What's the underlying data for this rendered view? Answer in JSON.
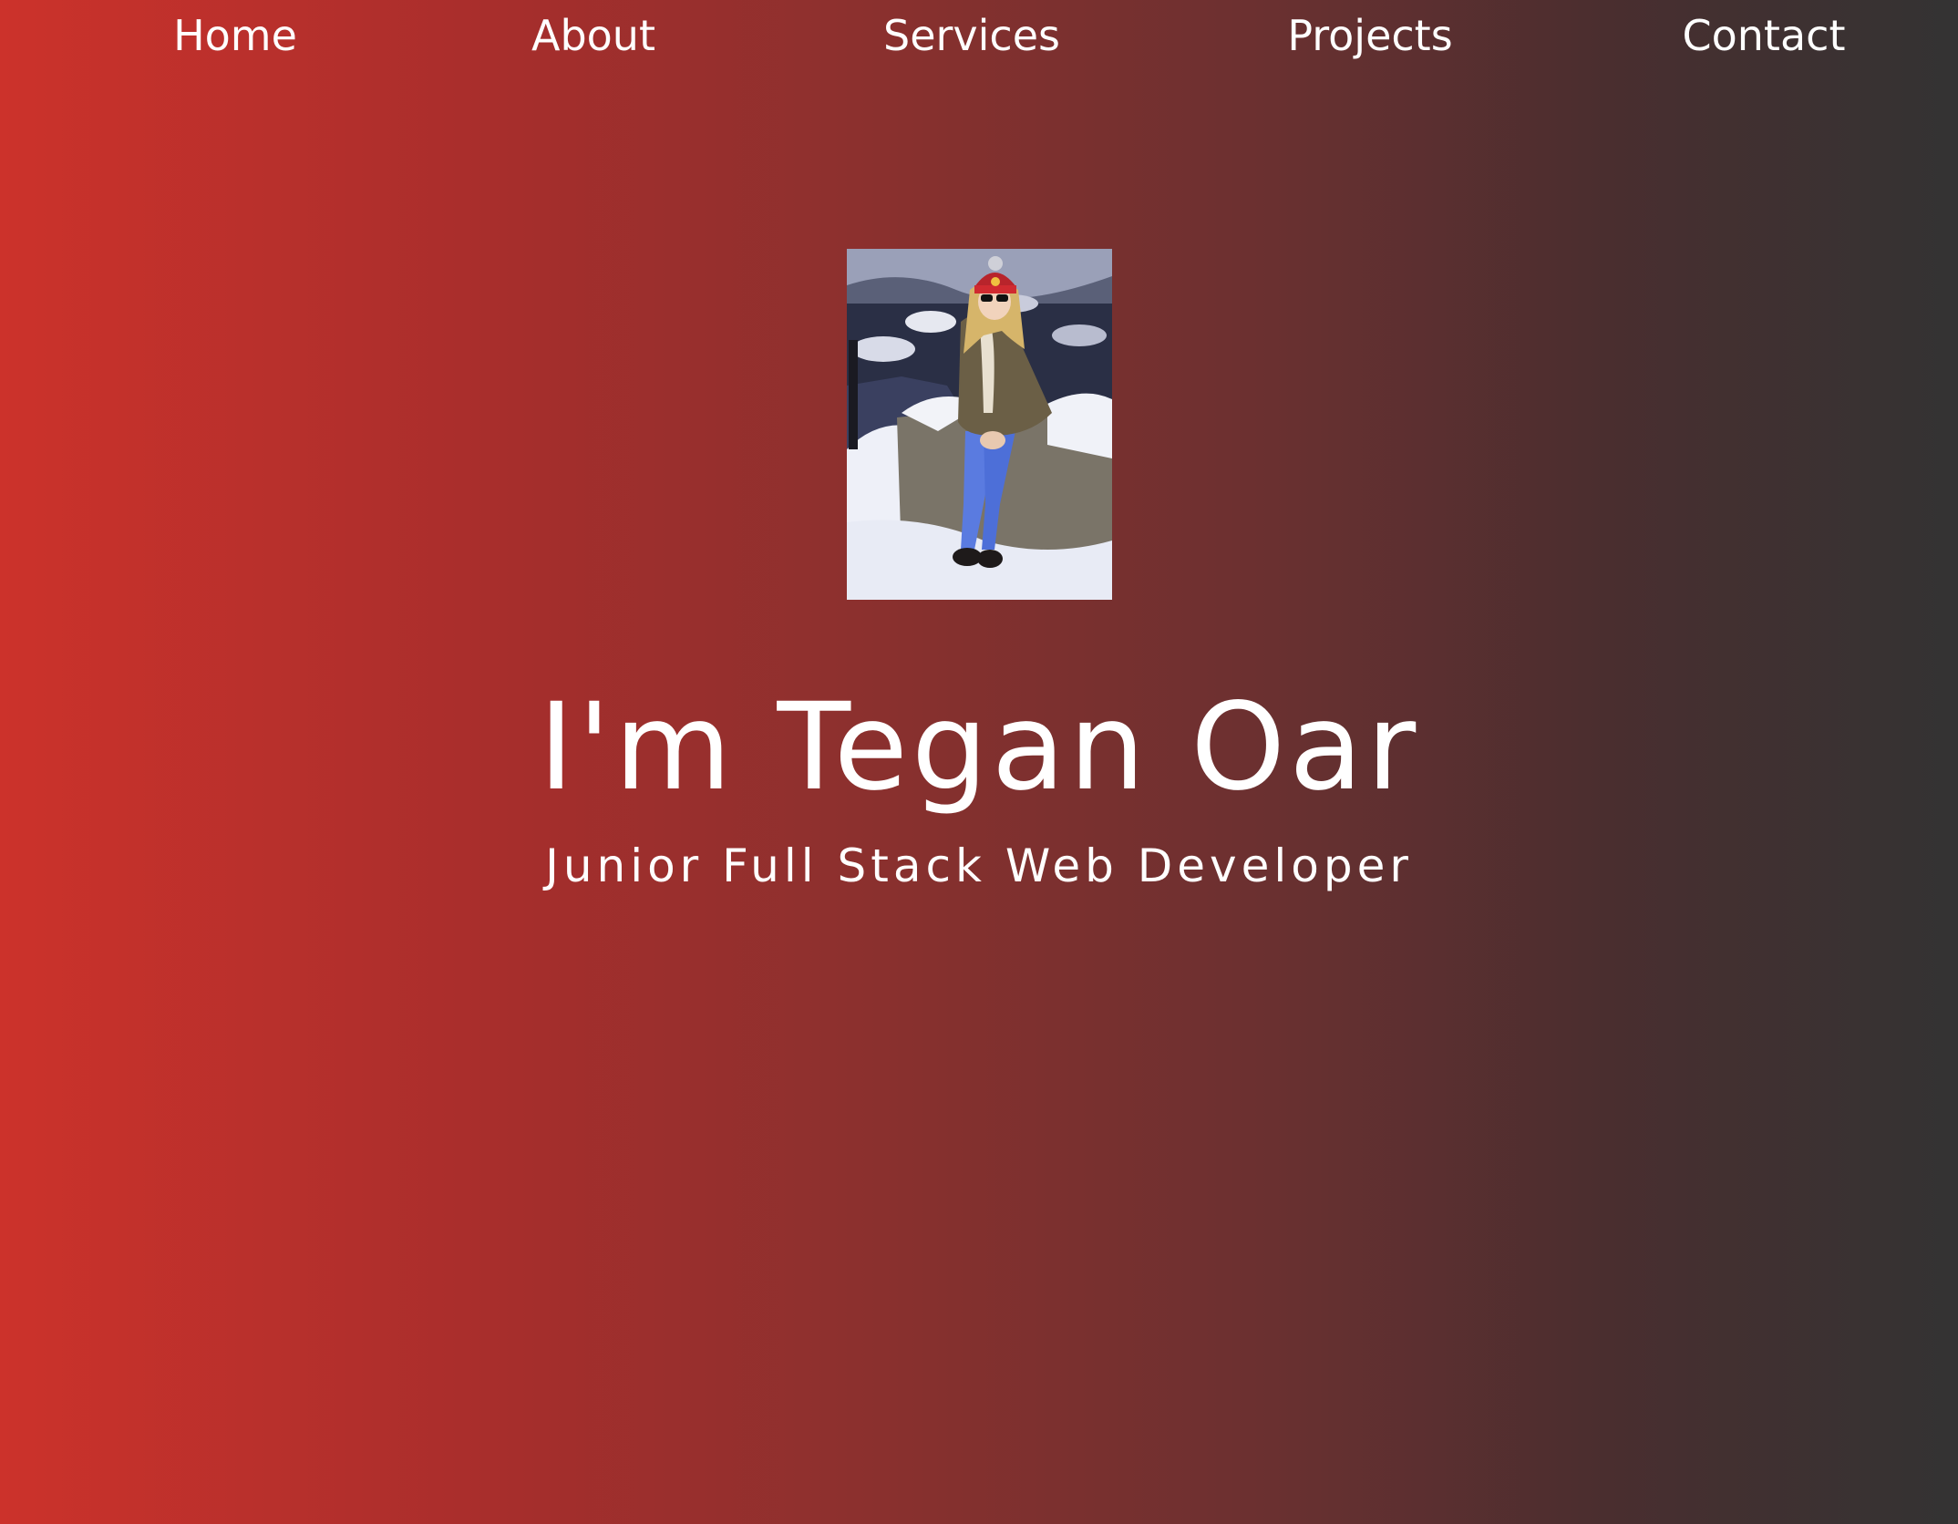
{
  "nav": {
    "items": [
      {
        "label": "Home"
      },
      {
        "label": "About"
      },
      {
        "label": "Services"
      },
      {
        "label": "Projects"
      },
      {
        "label": "Contact"
      }
    ]
  },
  "hero": {
    "title": "I'm Tegan Oar",
    "subtitle": "Junior Full Stack Web Developer"
  },
  "colors": {
    "gradient_start": "#cc322b",
    "gradient_end": "#333333",
    "text": "#ffffff"
  }
}
